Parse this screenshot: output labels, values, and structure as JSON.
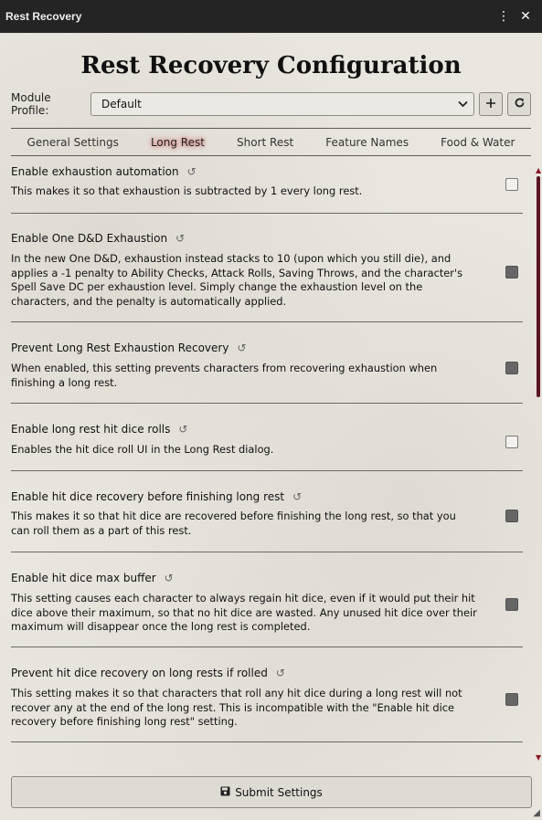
{
  "window": {
    "title": "Rest Recovery",
    "menu_icon": "vertical-ellipsis-icon",
    "close_icon": "close-icon"
  },
  "heading": "Rest Recovery Configuration",
  "profile": {
    "label": "Module Profile:",
    "value": "Default",
    "add_icon": "plus-icon",
    "refresh_icon": "refresh-icon"
  },
  "tabs": [
    {
      "label": "General Settings",
      "active": false
    },
    {
      "label": "Long Rest",
      "active": true
    },
    {
      "label": "Short Rest",
      "active": false
    },
    {
      "label": "Feature Names",
      "active": false
    },
    {
      "label": "Food & Water",
      "active": false
    }
  ],
  "settings": [
    {
      "name": "Enable exhaustion automation",
      "desc": "This makes it so that exhaustion is subtracted by 1 every long rest.",
      "checked": false
    },
    {
      "name": "Enable One D&D Exhaustion",
      "desc": "In the new One D&D, exhaustion instead stacks to 10 (upon which you still die), and applies a -1 penalty to Ability Checks, Attack Rolls, Saving Throws, and the character's Spell Save DC per exhaustion level. Simply change the exhaustion level on the characters, and the penalty is automatically applied.",
      "checked": true
    },
    {
      "name": "Prevent Long Rest Exhaustion Recovery",
      "desc": "When enabled, this setting prevents characters from recovering exhaustion when finishing a long rest.",
      "checked": true
    },
    {
      "name": "Enable long rest hit dice rolls",
      "desc": "Enables the hit dice roll UI in the Long Rest dialog.",
      "checked": false
    },
    {
      "name": "Enable hit dice recovery before finishing long rest",
      "desc": "This makes it so that hit dice are recovered before finishing the long rest, so that you can roll them as a part of this rest.",
      "checked": true
    },
    {
      "name": "Enable hit dice max buffer",
      "desc": "This setting causes each character to always regain hit dice, even if it would put their hit dice above their maximum, so that no hit dice are wasted. Any unused hit dice over their maximum will disappear once the long rest is completed.",
      "checked": true
    },
    {
      "name": "Prevent hit dice recovery on long rests if rolled",
      "desc": "This setting makes it so that characters that roll any hit dice during a long rest will not recover any at the end of the long rest. This is incompatible with the \"Enable hit dice recovery before finishing long rest\" setting.",
      "checked": true
    }
  ],
  "submit": {
    "label": "Submit Settings",
    "icon": "save-icon"
  }
}
